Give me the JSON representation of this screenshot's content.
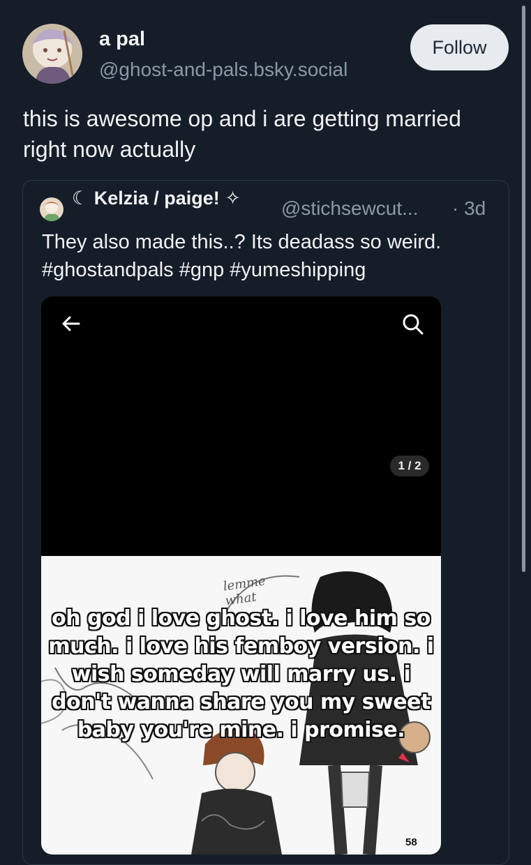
{
  "post": {
    "author_name": "a pal",
    "author_handle": "@ghost-and-pals.bsky.social",
    "follow_label": "Follow",
    "text": "this is awesome op and i are getting married right now actually"
  },
  "quoted_post": {
    "author_name": "☾ Kelzia / paige! ✧",
    "author_handle": "@stichsewcut...",
    "time": "· 3d",
    "text": "They also made this..? Its deadass so weird. #ghostandpals #gnp #yumeshipping",
    "media": {
      "counter": "1 / 2",
      "caption": "oh god i love ghost. i love him so much. i love his femboy version. i wish someday will marry us. i don't wanna share you my sweet baby you're mine. i promise.",
      "sketch_text": "lemme what",
      "page_number": "58"
    }
  },
  "colors": {
    "background": "#151d28",
    "secondary_text": "#8b98a8",
    "follow_button_bg": "#e7ebf0"
  },
  "icons": {
    "back": "arrow-left-icon",
    "search": "search-icon"
  }
}
